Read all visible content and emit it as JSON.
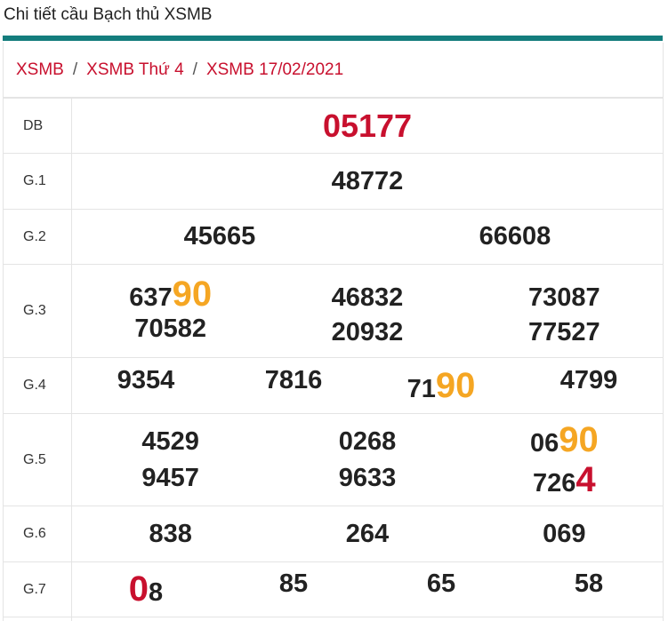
{
  "page_title": "Chi tiết cầu Bạch thủ XSMB",
  "breadcrumb": [
    "XSMB",
    "XSMB Thứ 4",
    "XSMB 17/02/2021"
  ],
  "breadcrumb_separator": "/",
  "colors": {
    "accent_bar": "#147d7d",
    "red": "#c8102e",
    "orange": "#f5a623"
  },
  "rows": {
    "db": {
      "label": "DB",
      "value": "05177"
    },
    "g1": {
      "label": "G.1",
      "value": "48772"
    },
    "g2": {
      "label": "G.2",
      "values": [
        "45665",
        "66608"
      ]
    },
    "g3": {
      "label": "G.3",
      "col1": {
        "top_pre": "637",
        "top_hl": "90",
        "bottom": "70582"
      },
      "col2": {
        "top": "46832",
        "bottom": "20932"
      },
      "col3": {
        "top": "73087",
        "bottom": "77527"
      }
    },
    "g4": {
      "label": "G.4",
      "v1": "9354",
      "v2": "7816",
      "v3_pre": "71",
      "v3_hl": "90",
      "v4": "4799"
    },
    "g5": {
      "label": "G.5",
      "col1": {
        "top": "4529",
        "bottom": "9457"
      },
      "col2": {
        "top": "0268",
        "bottom": "9633"
      },
      "col3": {
        "top_pre": "06",
        "top_hl": "90",
        "bottom_pre": "726",
        "bottom_hl": "4"
      }
    },
    "g6": {
      "label": "G.6",
      "values": [
        "838",
        "264",
        "069"
      ]
    },
    "g7": {
      "label": "G.7",
      "v1_hl": "0",
      "v1_post": "8",
      "v2": "85",
      "v3": "65",
      "v4": "58"
    }
  }
}
